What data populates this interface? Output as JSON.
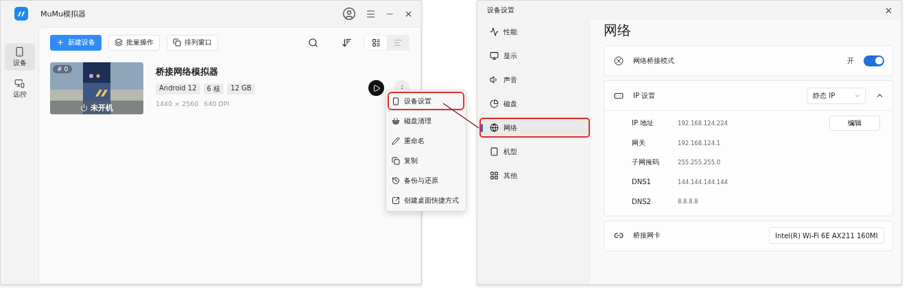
{
  "left_window": {
    "title": "MuMu模拟器",
    "sidebar": [
      {
        "label": "设备",
        "selected": true
      },
      {
        "label": "远控",
        "selected": false
      }
    ],
    "toolbar": {
      "new_button": "新建设备",
      "batch_button": "批量操作",
      "arrange_button": "排列窗口",
      "views": [
        {
          "selected": true
        },
        {
          "selected": false
        }
      ]
    },
    "device": {
      "index": "# 0",
      "status": "未开机",
      "name": "桥接网络模拟器",
      "tags": [
        "Android 12",
        "6 核",
        "12 GB"
      ],
      "resolution": "1440 × 2560",
      "dpi": "640 DPI"
    },
    "context_menu": [
      {
        "kind": "settings",
        "label": "设备设置",
        "annotated": true
      },
      {
        "kind": "clean",
        "label": "磁盘清理",
        "annotated": false
      },
      {
        "kind": "rename",
        "label": "重命名",
        "annotated": false
      },
      {
        "kind": "copy",
        "label": "复制",
        "annotated": false
      },
      {
        "kind": "backup",
        "label": "备份与还原",
        "annotated": false
      },
      {
        "kind": "shortcut",
        "label": "创建桌面快捷方式",
        "annotated": false
      }
    ]
  },
  "right_window": {
    "title": "设备设置",
    "nav": [
      {
        "kind": "performance",
        "label": "性能",
        "selected": false,
        "annotated": false
      },
      {
        "kind": "display",
        "label": "显示",
        "selected": false,
        "annotated": false
      },
      {
        "kind": "sound",
        "label": "声音",
        "selected": false,
        "annotated": false
      },
      {
        "kind": "disk",
        "label": "磁盘",
        "selected": false,
        "annotated": false
      },
      {
        "kind": "network",
        "label": "网络",
        "selected": true,
        "annotated": true
      },
      {
        "kind": "model",
        "label": "机型",
        "selected": false,
        "annotated": false
      },
      {
        "kind": "other",
        "label": "其他",
        "selected": false,
        "annotated": false
      }
    ],
    "heading": "网络",
    "bridge_mode": {
      "label": "网络桥接模式",
      "state": "开",
      "on": true
    },
    "ip_settings": {
      "label": "IP 设置",
      "mode": "静态 IP",
      "expanded": true,
      "edit_button": "编辑",
      "rows": [
        {
          "label": "IP 地址",
          "value": "192.168.124.224"
        },
        {
          "label": "网关",
          "value": "192.168.124.1"
        },
        {
          "label": "子网掩码",
          "value": "255.255.255.0"
        },
        {
          "label": "DNS1",
          "value": "144.144.144.144"
        },
        {
          "label": "DNS2",
          "value": "8.8.8.8"
        }
      ]
    },
    "adapter": {
      "label": "桥接网卡",
      "value": "Intel(R) Wi-Fi 6E AX211 160MI"
    }
  }
}
